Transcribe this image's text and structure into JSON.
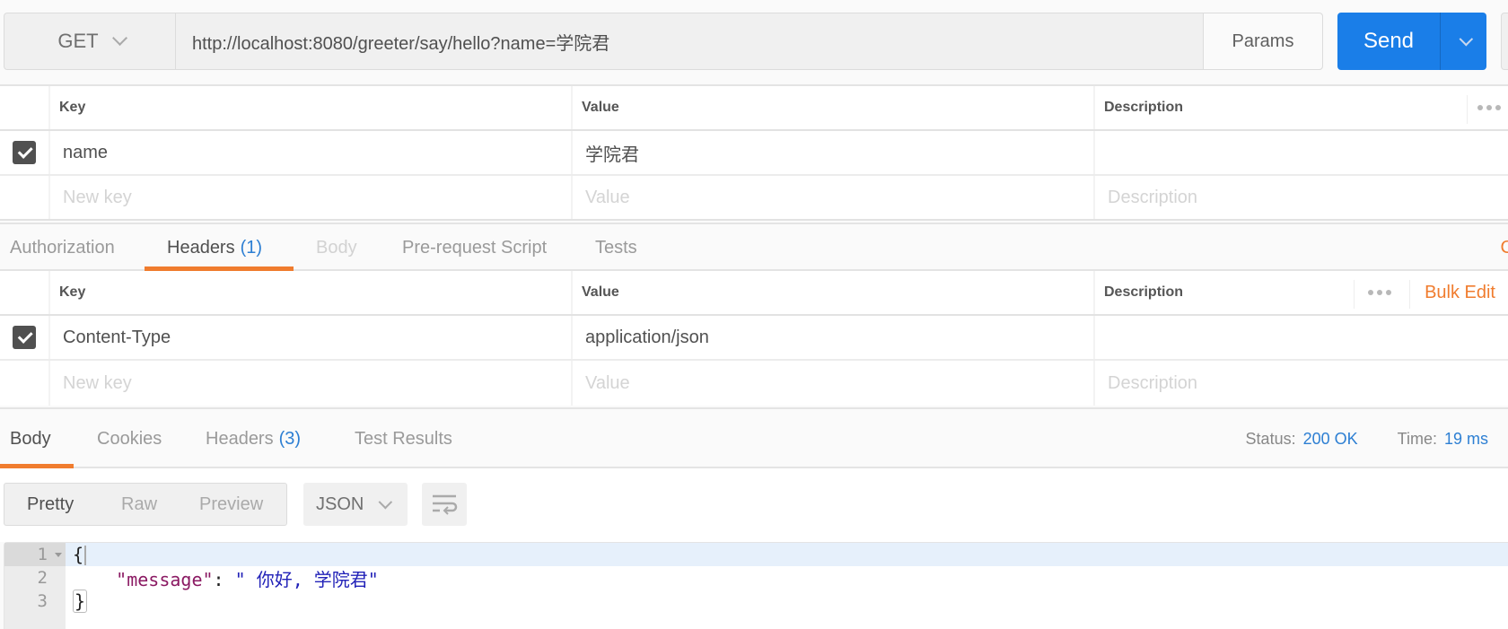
{
  "request": {
    "method": "GET",
    "url": "http://localhost:8080/greeter/say/hello?name=学院君",
    "params_label": "Params",
    "send_label": "Send"
  },
  "params_table": {
    "headers": {
      "key": "Key",
      "value": "Value",
      "description": "Description"
    },
    "rows": [
      {
        "checked": true,
        "key": "name",
        "value": "学院君",
        "description": ""
      }
    ],
    "new_row": {
      "key_placeholder": "New key",
      "value_placeholder": "Value",
      "description_placeholder": "Description"
    }
  },
  "request_tabs": {
    "items": [
      {
        "label": "Authorization",
        "state": "normal"
      },
      {
        "label": "Headers",
        "count": "(1)",
        "state": "active"
      },
      {
        "label": "Body",
        "state": "disabled"
      },
      {
        "label": "Pre-request Script",
        "state": "normal"
      },
      {
        "label": "Tests",
        "state": "normal"
      }
    ],
    "right_link_partial": "C"
  },
  "headers_table": {
    "headers": {
      "key": "Key",
      "value": "Value",
      "description": "Description"
    },
    "bulk_edit_label": "Bulk Edit",
    "rows": [
      {
        "checked": true,
        "key": "Content-Type",
        "value": "application/json",
        "description": ""
      }
    ],
    "new_row": {
      "key_placeholder": "New key",
      "value_placeholder": "Value",
      "description_placeholder": "Description"
    }
  },
  "response": {
    "tabs": [
      {
        "label": "Body",
        "state": "active"
      },
      {
        "label": "Cookies",
        "state": "normal"
      },
      {
        "label": "Headers",
        "count": "(3)",
        "state": "normal"
      },
      {
        "label": "Test Results",
        "state": "normal"
      }
    ],
    "status_label": "Status:",
    "status_value": "200 OK",
    "time_label": "Time:",
    "time_value": "19 ms",
    "view_modes": [
      "Pretty",
      "Raw",
      "Preview"
    ],
    "active_view": "Pretty",
    "format": "JSON",
    "code_lines": [
      {
        "n": "1",
        "text": "{"
      },
      {
        "n": "2",
        "key": "\"message\"",
        "sep": ": ",
        "value": "\" 你好, 学院君\""
      },
      {
        "n": "3",
        "text": "}"
      }
    ]
  },
  "colors": {
    "accent_orange": "#f07c2e",
    "send_blue": "#1a7ee8",
    "link_blue": "#2d7fd3"
  }
}
